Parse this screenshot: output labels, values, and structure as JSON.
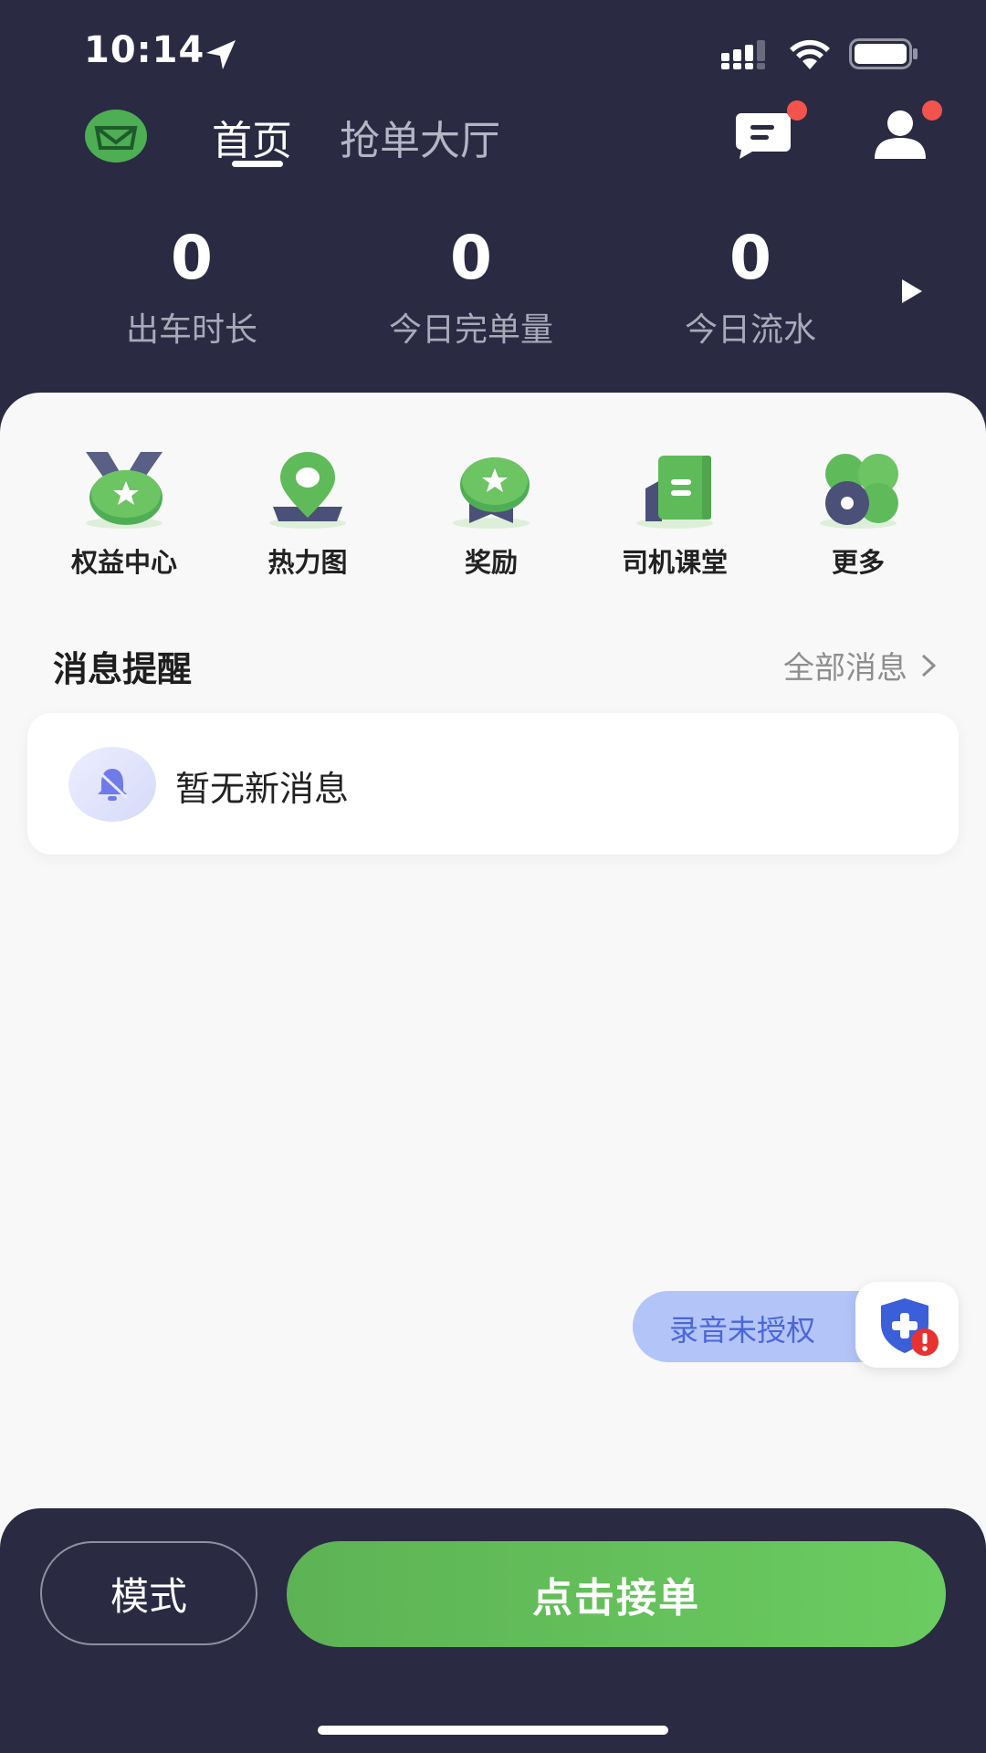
{
  "status_bar": {
    "time": "10:14"
  },
  "header": {
    "tabs": [
      {
        "label": "首页",
        "active": true
      },
      {
        "label": "抢单大厅",
        "active": false
      }
    ]
  },
  "stats": [
    {
      "value": "0",
      "label": "出车时长"
    },
    {
      "value": "0",
      "label": "今日完单量"
    },
    {
      "value": "0",
      "label": "今日流水"
    }
  ],
  "quick_actions": [
    {
      "label": "权益中心",
      "icon": "medal-star-icon"
    },
    {
      "label": "热力图",
      "icon": "map-pin-icon"
    },
    {
      "label": "奖励",
      "icon": "award-ribbon-icon"
    },
    {
      "label": "司机课堂",
      "icon": "book-icon"
    },
    {
      "label": "更多",
      "icon": "more-grid-icon"
    }
  ],
  "messages": {
    "title": "消息提醒",
    "all_link": "全部消息",
    "empty_text": "暂无新消息"
  },
  "recording": {
    "status": "录音未授权"
  },
  "bottom": {
    "mode_label": "模式",
    "accept_label": "点击接单"
  },
  "colors": {
    "dark_bg": "#2A2A43",
    "accent_green": "#5DB354",
    "badge_red": "#F2544D",
    "rec_blue": "#B3C4F8"
  }
}
